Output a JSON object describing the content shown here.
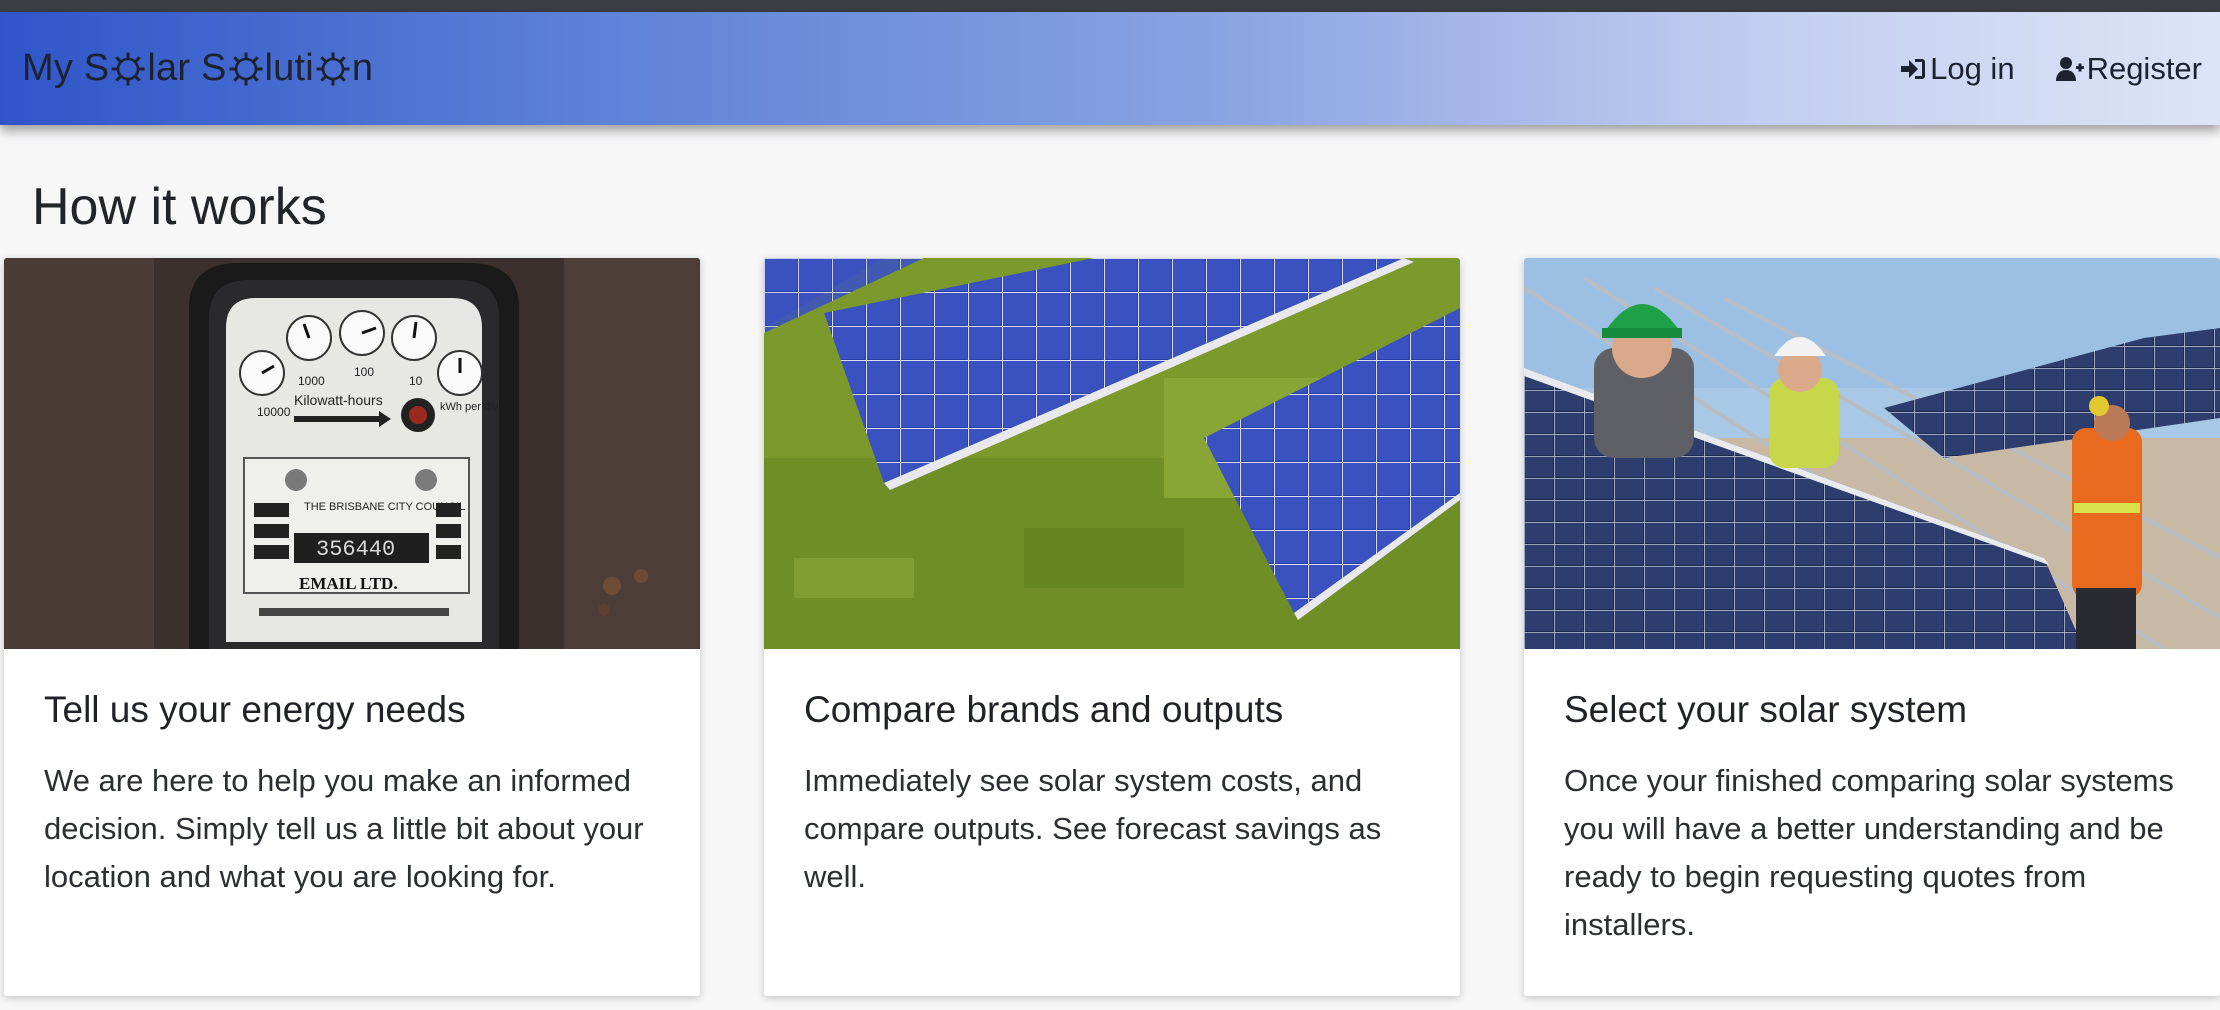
{
  "navbar": {
    "brand_parts": [
      "My S",
      "lar S",
      "luti",
      "n"
    ],
    "login_label": "Log in",
    "register_label": "Register"
  },
  "main": {
    "heading": "How it works",
    "cards": [
      {
        "title": "Tell us your energy needs",
        "text": "We are here to help you make an informed decision. Simply tell us a little bit about your location and what you are looking for.",
        "image": {
          "meter_label": "Kilowatt-hours",
          "dials": [
            "10000",
            "1000",
            "100",
            "10"
          ],
          "kwh_label": "kWh per div.",
          "council": "THE BRISBANE CITY COUNCIL",
          "reading": "356440",
          "maker": "EMAIL LTD."
        }
      },
      {
        "title": "Compare brands and outputs",
        "text": "Immediately see solar system costs, and compare outputs. See forecast savings as well."
      },
      {
        "title": "Select your solar system",
        "text": "Once your finished comparing solar systems you will have a better understanding and be ready to begin requesting quotes from installers."
      }
    ]
  },
  "colors": {
    "nav_start": "#2f55c9",
    "nav_end": "#dde4f7",
    "text": "#212529"
  },
  "icons": [
    "sun-icon",
    "sign-in-icon",
    "user-plus-icon"
  ]
}
